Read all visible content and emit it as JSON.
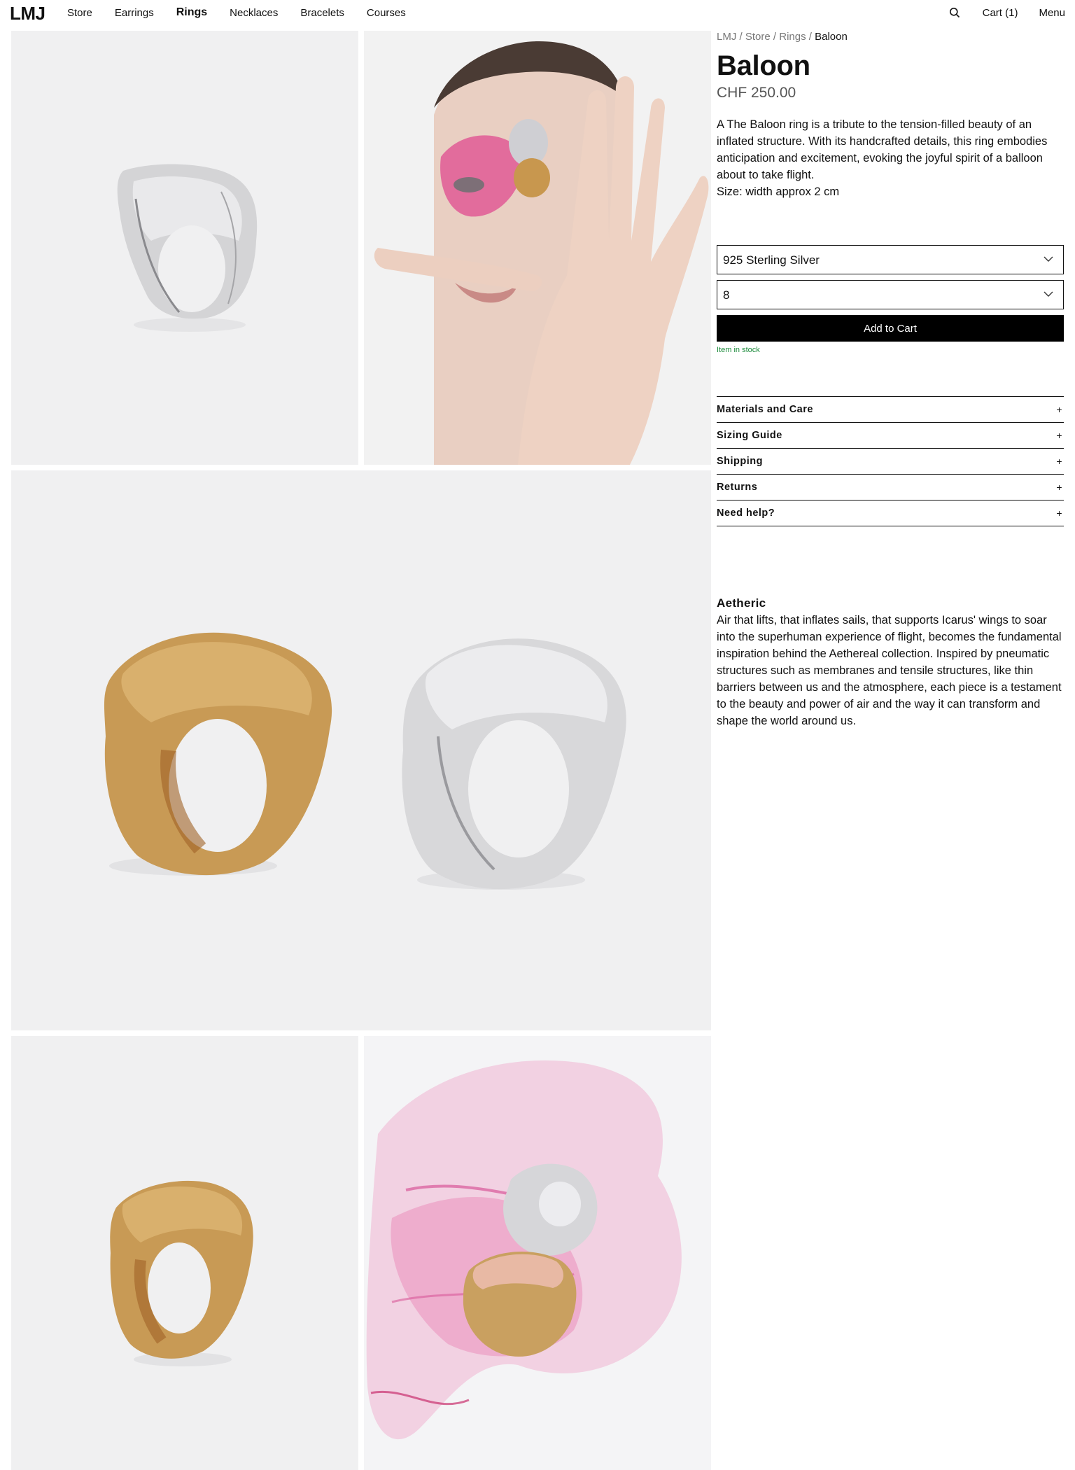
{
  "header": {
    "logo": "LMJ",
    "nav": [
      "Store",
      "Earrings",
      "Rings",
      "Necklaces",
      "Bracelets",
      "Courses"
    ],
    "active_nav": "Rings",
    "search_icon": "search-icon",
    "cart_label": "Cart (1)",
    "menu_label": "Menu"
  },
  "breadcrumb": {
    "items": [
      "LMJ",
      "Store",
      "Rings"
    ],
    "separator": "/",
    "current": "Baloon"
  },
  "product": {
    "title": "Baloon",
    "price": "CHF 250.00",
    "description": "A The Baloon ring is a tribute to the tension-filled beauty of an inflated structure. With its handcrafted details, this ring embodies anticipation and excitement, evoking the joyful spirit of a balloon about to take flight.",
    "size_info": "Size: width approx 2 cm",
    "material_select": "925 Sterling Silver",
    "size_select": "8",
    "add_to_cart": "Add to Cart",
    "stock_status": "Item in stock",
    "stock_color": "#1a8a3a"
  },
  "accordion": [
    {
      "label": "Materials and Care",
      "icon": "+"
    },
    {
      "label": "Sizing Guide",
      "icon": "+"
    },
    {
      "label": "Shipping",
      "icon": "+"
    },
    {
      "label": "Returns",
      "icon": "+"
    },
    {
      "label": "Need help?",
      "icon": "+"
    }
  ],
  "collection": {
    "title": "Aetheric",
    "text": "Air that lifts, that inflates sails, that supports Icarus' wings to soar into the superhuman experience of flight, becomes the fundamental inspiration behind the Aethereal collection. Inspired by pneumatic structures such as membranes and tensile structures, like thin barriers between us and the atmosphere, each piece is a testament to the beauty and power of air and the way it can transform and shape the world around us."
  },
  "gallery": {
    "images": [
      "silver-ring-photo",
      "model-wearing-rings-photo",
      "gold-and-silver-rings-photo",
      "gold-ring-photo",
      "rings-on-pink-plastic-photo"
    ],
    "colors": {
      "background": "#f0f0f1",
      "silver": "#d9d9db",
      "gold": "#c89a55",
      "pink": "#e0609a"
    }
  }
}
